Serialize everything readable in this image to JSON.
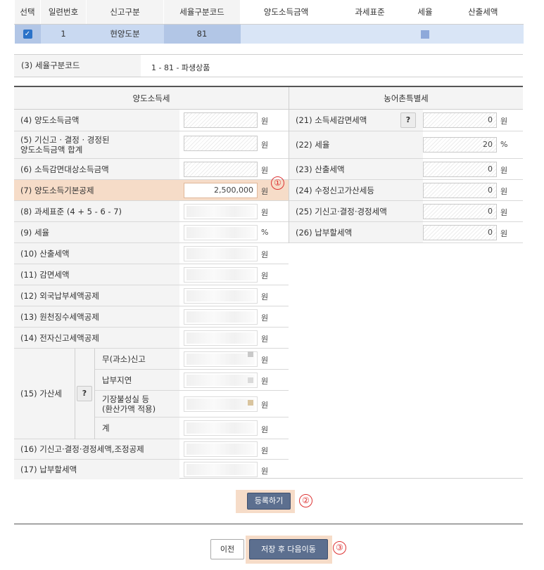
{
  "top_grid": {
    "headers": [
      "선택",
      "일련번호",
      "신고구분",
      "세율구분코드",
      "양도소득금액",
      "과세표준",
      "세율",
      "산출세액"
    ],
    "row": {
      "serial": "1",
      "report_type": "현양도분",
      "rate_code": "81"
    }
  },
  "rate_code": {
    "label": "(3) 세율구분코드",
    "value": "1 - 81 - 파생상품"
  },
  "left": {
    "title": "양도소득세",
    "rows": [
      {
        "label": "(4) 양도소득금액",
        "value": "",
        "unit": "원"
      },
      {
        "label": "(5) 기신고 · 결정 · 경정된\n양도소득금액 합계",
        "value": "",
        "unit": "원"
      },
      {
        "label": "(6) 소득감면대상소득금액",
        "value": "",
        "unit": "원"
      },
      {
        "label": "(7) 양도소득기본공제",
        "value": "2,500,000",
        "unit": "원"
      },
      {
        "label": "(8) 과세표준 (4 + 5 - 6 - 7)",
        "value": "",
        "unit": "원"
      },
      {
        "label": "(9) 세율",
        "value": "",
        "unit": "%"
      },
      {
        "label": "(10) 산출세액",
        "value": "",
        "unit": "원"
      },
      {
        "label": "(11) 감면세액",
        "value": "",
        "unit": "원"
      },
      {
        "label": "(12) 외국납부세액공제",
        "value": "",
        "unit": "원"
      },
      {
        "label": "(13) 원천징수세액공제",
        "value": "",
        "unit": "원"
      },
      {
        "label": "(14) 전자신고세액공제",
        "value": "",
        "unit": "원"
      }
    ],
    "penalty": {
      "label": "(15) 가산세",
      "help": "?",
      "items": [
        {
          "label": "무(과소)신고",
          "unit": "원"
        },
        {
          "label": "납부지연",
          "unit": "원"
        },
        {
          "label": "기장불성실 등\n(환산가액 적용)",
          "unit": "원"
        },
        {
          "label": "계",
          "unit": "원"
        }
      ]
    },
    "row16": {
      "label": "(16) 기신고·결정·경정세액,조정공제",
      "unit": "원"
    },
    "row17": {
      "label": "(17) 납부할세액",
      "unit": "원"
    }
  },
  "right": {
    "title": "농어촌특별세",
    "rows": [
      {
        "label": "(21) 소득세감면세액",
        "value": "0",
        "unit": "원",
        "help": "?"
      },
      {
        "label": "(22) 세율",
        "value": "20",
        "unit": "%"
      },
      {
        "label": "(23) 산출세액",
        "value": "0",
        "unit": "원"
      },
      {
        "label": "(24) 수정신고가산세등",
        "value": "0",
        "unit": "원"
      },
      {
        "label": "(25) 기신고·결정·경정세액",
        "value": "0",
        "unit": "원"
      },
      {
        "label": "(26) 납부할세액",
        "value": "0",
        "unit": "원"
      }
    ]
  },
  "markers": {
    "m1": "①",
    "m2": "②",
    "m3": "③"
  },
  "buttons": {
    "register": "등록하기",
    "prev": "이전",
    "save_next": "저장 후 다음이동"
  },
  "colors": {
    "highlight": "#f6dcc8",
    "marker": "#dd3333",
    "primary_button": "#5c6f8f",
    "selected_row": "#c9d9f1"
  }
}
